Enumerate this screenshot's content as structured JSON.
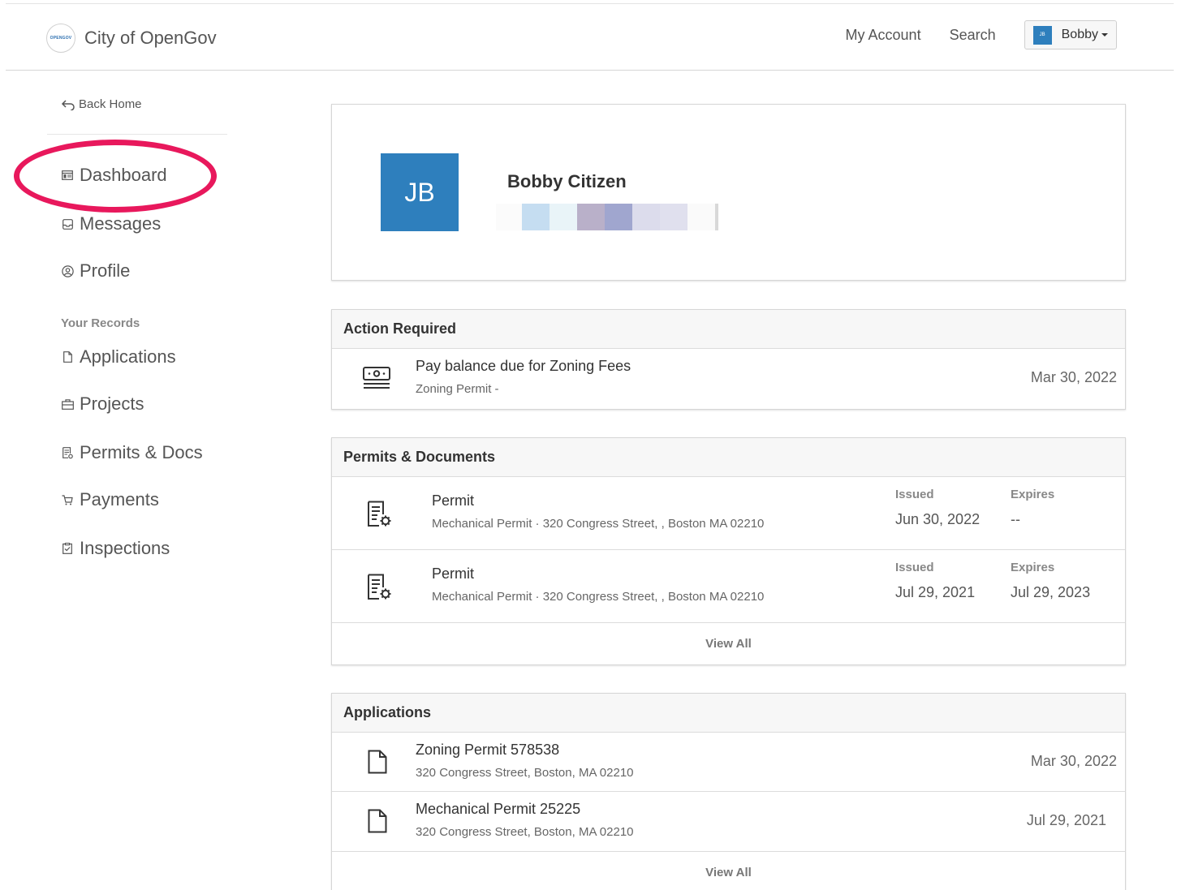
{
  "header": {
    "brand_name": "City of OpenGov",
    "logo_text": "OPENGOV",
    "nav": {
      "my_account": "My Account",
      "search": "Search"
    },
    "user": {
      "initials": "JB",
      "name": "Bobby"
    }
  },
  "sidebar": {
    "back_home": "Back Home",
    "items": [
      {
        "label": "Dashboard",
        "icon": "dashboard-icon",
        "highlighted": true
      },
      {
        "label": "Messages",
        "icon": "inbox-icon"
      },
      {
        "label": "Profile",
        "icon": "user-circle-icon"
      }
    ],
    "section_title": "Your Records",
    "records": [
      {
        "label": "Applications",
        "icon": "file-icon"
      },
      {
        "label": "Projects",
        "icon": "briefcase-icon"
      },
      {
        "label": "Permits & Docs",
        "icon": "permit-icon"
      },
      {
        "label": "Payments",
        "icon": "cart-icon"
      },
      {
        "label": "Inspections",
        "icon": "clipboard-icon"
      }
    ],
    "highlight_color": "#e8185c"
  },
  "profile": {
    "initials": "JB",
    "name": "Bobby Citizen",
    "avatar_color": "#2e7fbd"
  },
  "action_required": {
    "title": "Action Required",
    "items": [
      {
        "title": "Pay balance due for Zoning Fees",
        "subtitle": "Zoning Permit -",
        "date": "Mar 30, 2022",
        "icon": "money-icon"
      }
    ]
  },
  "permits": {
    "title": "Permits & Documents",
    "issued_label": "Issued",
    "expires_label": "Expires",
    "items": [
      {
        "title": "Permit",
        "subtitle": "Mechanical Permit · 320 Congress Street, , Boston MA 02210",
        "issued": "Jun 30, 2022",
        "expires": "--",
        "icon": "permit-doc-icon"
      },
      {
        "title": "Permit",
        "subtitle": "Mechanical Permit · 320 Congress Street, , Boston MA 02210",
        "issued": "Jul 29, 2021",
        "expires": "Jul 29, 2023",
        "icon": "permit-doc-icon"
      }
    ],
    "view_all": "View All"
  },
  "applications": {
    "title": "Applications",
    "items": [
      {
        "title": "Zoning Permit 578538",
        "subtitle": "320 Congress Street, Boston, MA 02210",
        "date": "Mar 30, 2022",
        "icon": "document-icon"
      },
      {
        "title": "Mechanical Permit 25225",
        "subtitle": "320 Congress Street, Boston, MA 02210",
        "date": "Jul 29, 2021",
        "icon": "document-icon"
      }
    ],
    "view_all": "View All"
  }
}
